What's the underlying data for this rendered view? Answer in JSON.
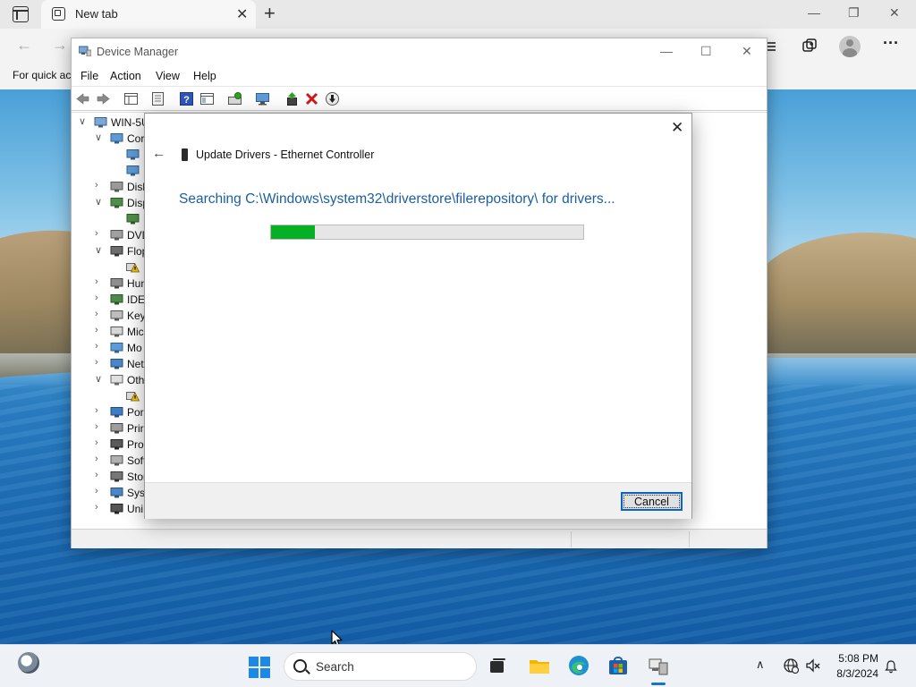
{
  "browser": {
    "tab_title": "New tab",
    "tab_close": "✕",
    "new_tab": "+",
    "favorites_bar_text": "For quick ac",
    "more_label": "···"
  },
  "window_controls": {
    "minimize": "—",
    "maximize": "❐",
    "close": "✕"
  },
  "device_manager": {
    "title": "Device Manager",
    "menu": [
      "File",
      "Action",
      "View",
      "Help"
    ],
    "tree": [
      {
        "arrow": "∨",
        "label": "WIN-5U",
        "indent": 0,
        "icon": "computer-icon"
      },
      {
        "arrow": "∨",
        "label": "Cor",
        "indent": 1,
        "icon": "monitor-icon"
      },
      {
        "arrow": "",
        "label": "",
        "indent": 2,
        "icon": "monitor-icon"
      },
      {
        "arrow": "",
        "label": "",
        "indent": 2,
        "icon": "monitor-icon"
      },
      {
        "arrow": "›",
        "label": "Disk",
        "indent": 1,
        "icon": "disk-icon"
      },
      {
        "arrow": "∨",
        "label": "Disp",
        "indent": 1,
        "icon": "display-adapter-icon"
      },
      {
        "arrow": "",
        "label": "",
        "indent": 2,
        "icon": "display-adapter-icon"
      },
      {
        "arrow": "›",
        "label": "DVD",
        "indent": 1,
        "icon": "dvd-drive-icon"
      },
      {
        "arrow": "∨",
        "label": "Flop",
        "indent": 1,
        "icon": "floppy-icon"
      },
      {
        "arrow": "",
        "label": "",
        "indent": 2,
        "icon": "warning-icon"
      },
      {
        "arrow": "›",
        "label": "Hun",
        "indent": 1,
        "icon": "hid-icon"
      },
      {
        "arrow": "›",
        "label": "IDE",
        "indent": 1,
        "icon": "ide-icon"
      },
      {
        "arrow": "›",
        "label": "Key",
        "indent": 1,
        "icon": "keyboard-icon"
      },
      {
        "arrow": "›",
        "label": "Mic",
        "indent": 1,
        "icon": "mouse-icon"
      },
      {
        "arrow": "›",
        "label": "Mo",
        "indent": 1,
        "icon": "monitor-icon"
      },
      {
        "arrow": "›",
        "label": "Net",
        "indent": 1,
        "icon": "network-icon"
      },
      {
        "arrow": "∨",
        "label": "Oth",
        "indent": 1,
        "icon": "other-devices-icon"
      },
      {
        "arrow": "",
        "label": "",
        "indent": 2,
        "icon": "warning-icon"
      },
      {
        "arrow": "›",
        "label": "Por",
        "indent": 1,
        "icon": "port-icon"
      },
      {
        "arrow": "›",
        "label": "Prir",
        "indent": 1,
        "icon": "printer-icon"
      },
      {
        "arrow": "›",
        "label": "Pro",
        "indent": 1,
        "icon": "processor-icon"
      },
      {
        "arrow": "›",
        "label": "Soft",
        "indent": 1,
        "icon": "software-device-icon"
      },
      {
        "arrow": "›",
        "label": "Stor",
        "indent": 1,
        "icon": "storage-icon"
      },
      {
        "arrow": "›",
        "label": "Syst",
        "indent": 1,
        "icon": "system-icon"
      },
      {
        "arrow": "›",
        "label": "Uni",
        "indent": 1,
        "icon": "usb-icon"
      }
    ]
  },
  "dialog": {
    "close": "✕",
    "back": "←",
    "title": "Update Drivers - Ethernet Controller",
    "status": "Searching C:\\Windows\\system32\\driverstore\\filerepository\\ for drivers...",
    "progress": 0.14,
    "cancel_label": "Cancel"
  },
  "taskbar": {
    "search_placeholder": "Search",
    "tray_chevron": "∧",
    "time": "5:08 PM",
    "date": "8/3/2024"
  },
  "colors": {
    "progress_fill": "#06b025",
    "status_text": "#1c5fa0",
    "accent": "#0a64c8"
  }
}
